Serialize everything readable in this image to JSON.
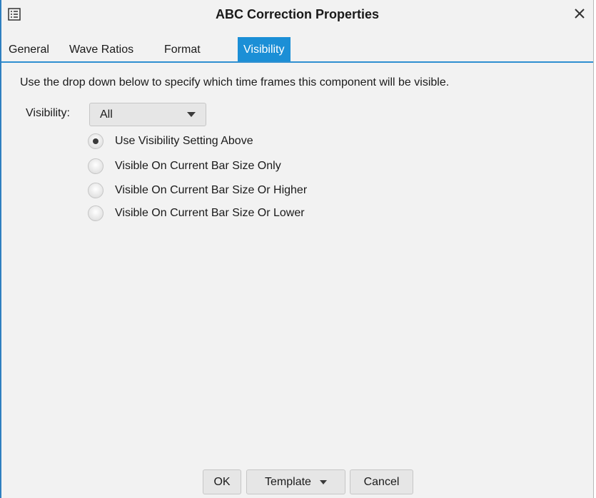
{
  "window": {
    "title": "ABC Correction Properties",
    "icon": "properties-icon",
    "close": "close-icon"
  },
  "tabs": [
    {
      "label": "General",
      "active": false
    },
    {
      "label": "Wave Ratios",
      "active": false
    },
    {
      "label": "Format",
      "active": false
    },
    {
      "label": "Visibility",
      "active": true
    }
  ],
  "visibility_tab": {
    "description": "Use the drop down below to specify which time frames this component will be visible.",
    "visibility_label": "Visibility:",
    "visibility_value": "All",
    "options": [
      {
        "label": "Use Visibility Setting Above",
        "checked": true
      },
      {
        "label": "Visible On Current Bar Size Only",
        "checked": false
      },
      {
        "label": "Visible On Current Bar Size Or Higher",
        "checked": false
      },
      {
        "label": "Visible On Current Bar Size Or Lower",
        "checked": false
      }
    ]
  },
  "buttons": {
    "ok": "OK",
    "template": "Template",
    "cancel": "Cancel"
  },
  "colors": {
    "accent": "#1b8fd6",
    "window_border": "#2f7fc0",
    "background": "#f2f2f2"
  }
}
